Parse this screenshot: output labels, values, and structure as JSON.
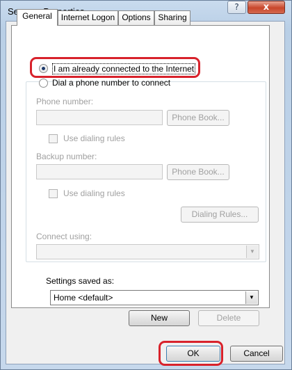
{
  "window": {
    "title": "Semvpn Properties",
    "help_icon": "?",
    "close_icon": "x"
  },
  "tabs": [
    "General",
    "Internet Logon",
    "Options",
    "Sharing"
  ],
  "general": {
    "radio_connected": {
      "label": "I am already connected to the Internet",
      "checked": true
    },
    "radio_dial": {
      "label": "Dial a phone number to connect",
      "checked": false
    },
    "phone_number_label": "Phone number:",
    "phone_book_button": "Phone Book...",
    "use_dialing_rules_1": "Use dialing rules",
    "backup_number_label": "Backup number:",
    "phone_book_button_2": "Phone Book...",
    "use_dialing_rules_2": "Use dialing rules",
    "dialing_rules_button": "Dialing Rules...",
    "connect_using_label": "Connect using:",
    "settings_saved_as_label": "Settings saved as:",
    "settings_saved_as_value": "Home <default>",
    "new_button": "New",
    "delete_button": "Delete"
  },
  "footer": {
    "ok_button": "OK",
    "cancel_button": "Cancel"
  },
  "colors": {
    "highlight": "#d8222b",
    "close_button": "#c8462b"
  }
}
